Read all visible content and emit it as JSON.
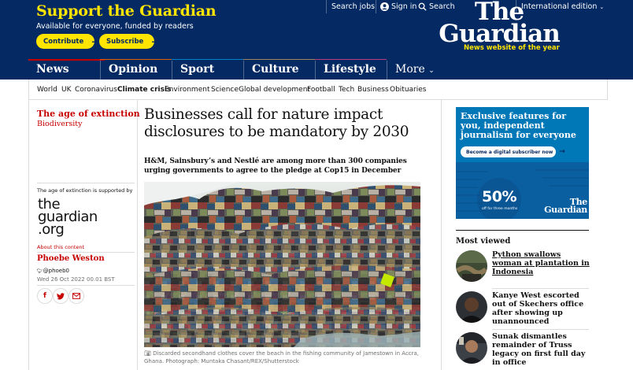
{
  "support": {
    "title": "Support the Guardian",
    "subtitle": "Available for everyone, funded by readers",
    "contribute_label": "Contribute",
    "subscribe_label": "Subscribe"
  },
  "top_links": {
    "search_jobs": "Search jobs",
    "sign_in": "Sign in",
    "search": "Search",
    "edition": "International edition"
  },
  "brand": {
    "logo_line1": "The",
    "logo_line2": "Guardian",
    "tagline": "News website of the year"
  },
  "pillars": [
    {
      "label": "News",
      "color": "#c70000"
    },
    {
      "label": "Opinion"
    },
    {
      "label": "Sport"
    },
    {
      "label": "Culture"
    },
    {
      "label": "Lifestyle"
    },
    {
      "label": "More"
    }
  ],
  "subnav": [
    "World",
    "UK",
    "Coronavirus",
    "Climate crisis",
    "Environment",
    "Science",
    "Global development",
    "Football",
    "Tech",
    "Business",
    "Obituaries"
  ],
  "article": {
    "series_title": "The age of extinction",
    "series_sub": "Biodiversity",
    "supported_by": "The age of extinction is supported by",
    "partner_logo": [
      "the",
      "guardian",
      ".org"
    ],
    "about_content": "About this content",
    "author": "Phoebe Weston",
    "twitter": "@phoeb0",
    "date": "Wed 26 Oct 2022 00.01 BST",
    "headline": "Businesses call for nature impact disclosures to be mandatory by 2030",
    "standfirst": "H&M, Sainsbury’s and Nestlé are among more than 300 companies urging governments to agree to the pledge at Cop15 in December",
    "caption": "Discarded secondhand clothes cover the beach in the fishing community of Jamestown in Accra, Ghana. Photograph: Muntaka Chasant/REX/Shutterstock"
  },
  "ad": {
    "headline": "Exclusive features for you, independent journalism for everyone",
    "button": "Become a digital subscriber now",
    "discount": "50%",
    "discount_sub": "off for three months",
    "logo_line1": "The",
    "logo_line2": "Guardian"
  },
  "most_viewed": {
    "title": "Most viewed",
    "items": [
      {
        "headline": "Python swallows woman at plantation in Indonesia"
      },
      {
        "headline": "Kanye West escorted out of Skechers office after showing up unannounced"
      },
      {
        "headline": "Sunak dismantles remainder of Truss legacy on first full day in office"
      }
    ]
  },
  "colors": {
    "brand_blue": "#052962",
    "support_yellow": "#ffe500",
    "news_red": "#c70000",
    "ad_blue": "#0077b6"
  }
}
